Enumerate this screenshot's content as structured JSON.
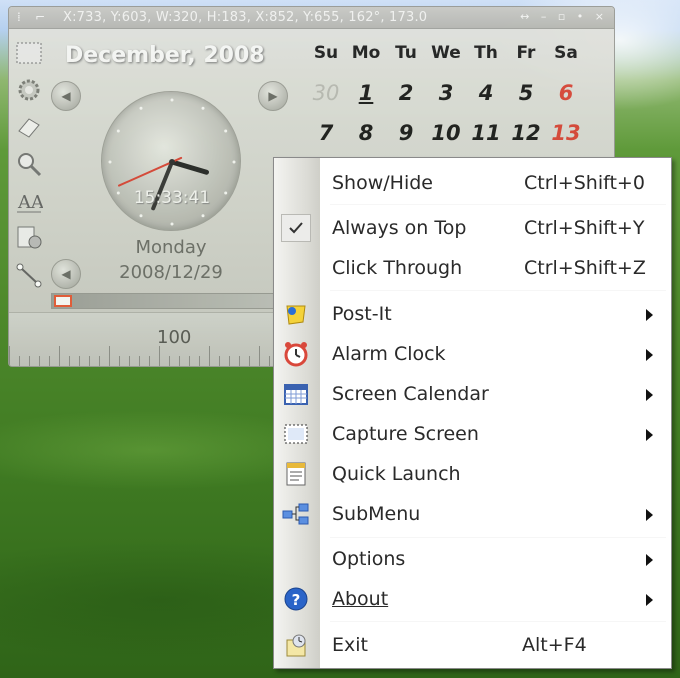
{
  "widget": {
    "titlebar": {
      "coords": "X:733, Y:603, W:320, H:183, X:852, Y:655, 162°, 173.0",
      "buttons": "↔ – ▫ • ×"
    },
    "month_title": "December, 2008",
    "clock": {
      "time": "15:33:41",
      "hour": 15,
      "minute": 33,
      "second": 41
    },
    "day_name": "Monday",
    "date_string": "2008/12/29",
    "calendar": {
      "headers": [
        "Su",
        "Mo",
        "Tu",
        "We",
        "Th",
        "Fr",
        "Sa"
      ],
      "week1": [
        "30",
        "1",
        "2",
        "3",
        "4",
        "5",
        "6"
      ],
      "week2": [
        "7",
        "8",
        "9",
        "10",
        "11",
        "12",
        "13"
      ]
    },
    "ruler_label": "100",
    "progress_value": 0.0
  },
  "menu": {
    "items": [
      {
        "label": "Show/Hide",
        "shortcut": "Ctrl+Shift+0"
      },
      {
        "label": "Always on Top",
        "shortcut": "Ctrl+Shift+Y",
        "checked": true
      },
      {
        "label": "Click Through",
        "shortcut": "Ctrl+Shift+Z"
      },
      {
        "label": "Post-It",
        "submenu": true,
        "icon": "post-it-icon"
      },
      {
        "label": "Alarm Clock",
        "submenu": true,
        "icon": "alarm-clock-icon"
      },
      {
        "label": "Screen Calendar",
        "submenu": true,
        "icon": "calendar-icon"
      },
      {
        "label": "Capture Screen",
        "submenu": true,
        "icon": "capture-screen-icon"
      },
      {
        "label": "Quick Launch",
        "icon": "quick-launch-icon"
      },
      {
        "label": "SubMenu",
        "submenu": true,
        "icon": "submenu-icon"
      },
      {
        "label": "Options",
        "submenu": true
      },
      {
        "label": "About",
        "submenu": true,
        "icon": "help-icon"
      },
      {
        "label": "Exit",
        "shortcut": "Alt+F4",
        "icon": "exit-icon"
      }
    ]
  },
  "colors": {
    "accent_red": "#d9483b",
    "menu_bg": "#ffffff",
    "help_blue": "#2a64c8"
  }
}
